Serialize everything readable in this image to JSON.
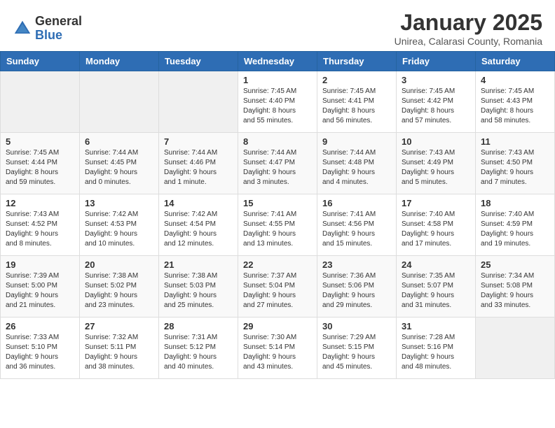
{
  "header": {
    "logo_general": "General",
    "logo_blue": "Blue",
    "month_title": "January 2025",
    "subtitle": "Unirea, Calarasi County, Romania"
  },
  "calendar": {
    "days_of_week": [
      "Sunday",
      "Monday",
      "Tuesday",
      "Wednesday",
      "Thursday",
      "Friday",
      "Saturday"
    ],
    "weeks": [
      [
        {
          "day": "",
          "info": ""
        },
        {
          "day": "",
          "info": ""
        },
        {
          "day": "",
          "info": ""
        },
        {
          "day": "1",
          "info": "Sunrise: 7:45 AM\nSunset: 4:40 PM\nDaylight: 8 hours\nand 55 minutes."
        },
        {
          "day": "2",
          "info": "Sunrise: 7:45 AM\nSunset: 4:41 PM\nDaylight: 8 hours\nand 56 minutes."
        },
        {
          "day": "3",
          "info": "Sunrise: 7:45 AM\nSunset: 4:42 PM\nDaylight: 8 hours\nand 57 minutes."
        },
        {
          "day": "4",
          "info": "Sunrise: 7:45 AM\nSunset: 4:43 PM\nDaylight: 8 hours\nand 58 minutes."
        }
      ],
      [
        {
          "day": "5",
          "info": "Sunrise: 7:45 AM\nSunset: 4:44 PM\nDaylight: 8 hours\nand 59 minutes."
        },
        {
          "day": "6",
          "info": "Sunrise: 7:44 AM\nSunset: 4:45 PM\nDaylight: 9 hours\nand 0 minutes."
        },
        {
          "day": "7",
          "info": "Sunrise: 7:44 AM\nSunset: 4:46 PM\nDaylight: 9 hours\nand 1 minute."
        },
        {
          "day": "8",
          "info": "Sunrise: 7:44 AM\nSunset: 4:47 PM\nDaylight: 9 hours\nand 3 minutes."
        },
        {
          "day": "9",
          "info": "Sunrise: 7:44 AM\nSunset: 4:48 PM\nDaylight: 9 hours\nand 4 minutes."
        },
        {
          "day": "10",
          "info": "Sunrise: 7:43 AM\nSunset: 4:49 PM\nDaylight: 9 hours\nand 5 minutes."
        },
        {
          "day": "11",
          "info": "Sunrise: 7:43 AM\nSunset: 4:50 PM\nDaylight: 9 hours\nand 7 minutes."
        }
      ],
      [
        {
          "day": "12",
          "info": "Sunrise: 7:43 AM\nSunset: 4:52 PM\nDaylight: 9 hours\nand 8 minutes."
        },
        {
          "day": "13",
          "info": "Sunrise: 7:42 AM\nSunset: 4:53 PM\nDaylight: 9 hours\nand 10 minutes."
        },
        {
          "day": "14",
          "info": "Sunrise: 7:42 AM\nSunset: 4:54 PM\nDaylight: 9 hours\nand 12 minutes."
        },
        {
          "day": "15",
          "info": "Sunrise: 7:41 AM\nSunset: 4:55 PM\nDaylight: 9 hours\nand 13 minutes."
        },
        {
          "day": "16",
          "info": "Sunrise: 7:41 AM\nSunset: 4:56 PM\nDaylight: 9 hours\nand 15 minutes."
        },
        {
          "day": "17",
          "info": "Sunrise: 7:40 AM\nSunset: 4:58 PM\nDaylight: 9 hours\nand 17 minutes."
        },
        {
          "day": "18",
          "info": "Sunrise: 7:40 AM\nSunset: 4:59 PM\nDaylight: 9 hours\nand 19 minutes."
        }
      ],
      [
        {
          "day": "19",
          "info": "Sunrise: 7:39 AM\nSunset: 5:00 PM\nDaylight: 9 hours\nand 21 minutes."
        },
        {
          "day": "20",
          "info": "Sunrise: 7:38 AM\nSunset: 5:02 PM\nDaylight: 9 hours\nand 23 minutes."
        },
        {
          "day": "21",
          "info": "Sunrise: 7:38 AM\nSunset: 5:03 PM\nDaylight: 9 hours\nand 25 minutes."
        },
        {
          "day": "22",
          "info": "Sunrise: 7:37 AM\nSunset: 5:04 PM\nDaylight: 9 hours\nand 27 minutes."
        },
        {
          "day": "23",
          "info": "Sunrise: 7:36 AM\nSunset: 5:06 PM\nDaylight: 9 hours\nand 29 minutes."
        },
        {
          "day": "24",
          "info": "Sunrise: 7:35 AM\nSunset: 5:07 PM\nDaylight: 9 hours\nand 31 minutes."
        },
        {
          "day": "25",
          "info": "Sunrise: 7:34 AM\nSunset: 5:08 PM\nDaylight: 9 hours\nand 33 minutes."
        }
      ],
      [
        {
          "day": "26",
          "info": "Sunrise: 7:33 AM\nSunset: 5:10 PM\nDaylight: 9 hours\nand 36 minutes."
        },
        {
          "day": "27",
          "info": "Sunrise: 7:32 AM\nSunset: 5:11 PM\nDaylight: 9 hours\nand 38 minutes."
        },
        {
          "day": "28",
          "info": "Sunrise: 7:31 AM\nSunset: 5:12 PM\nDaylight: 9 hours\nand 40 minutes."
        },
        {
          "day": "29",
          "info": "Sunrise: 7:30 AM\nSunset: 5:14 PM\nDaylight: 9 hours\nand 43 minutes."
        },
        {
          "day": "30",
          "info": "Sunrise: 7:29 AM\nSunset: 5:15 PM\nDaylight: 9 hours\nand 45 minutes."
        },
        {
          "day": "31",
          "info": "Sunrise: 7:28 AM\nSunset: 5:16 PM\nDaylight: 9 hours\nand 48 minutes."
        },
        {
          "day": "",
          "info": ""
        }
      ]
    ]
  }
}
